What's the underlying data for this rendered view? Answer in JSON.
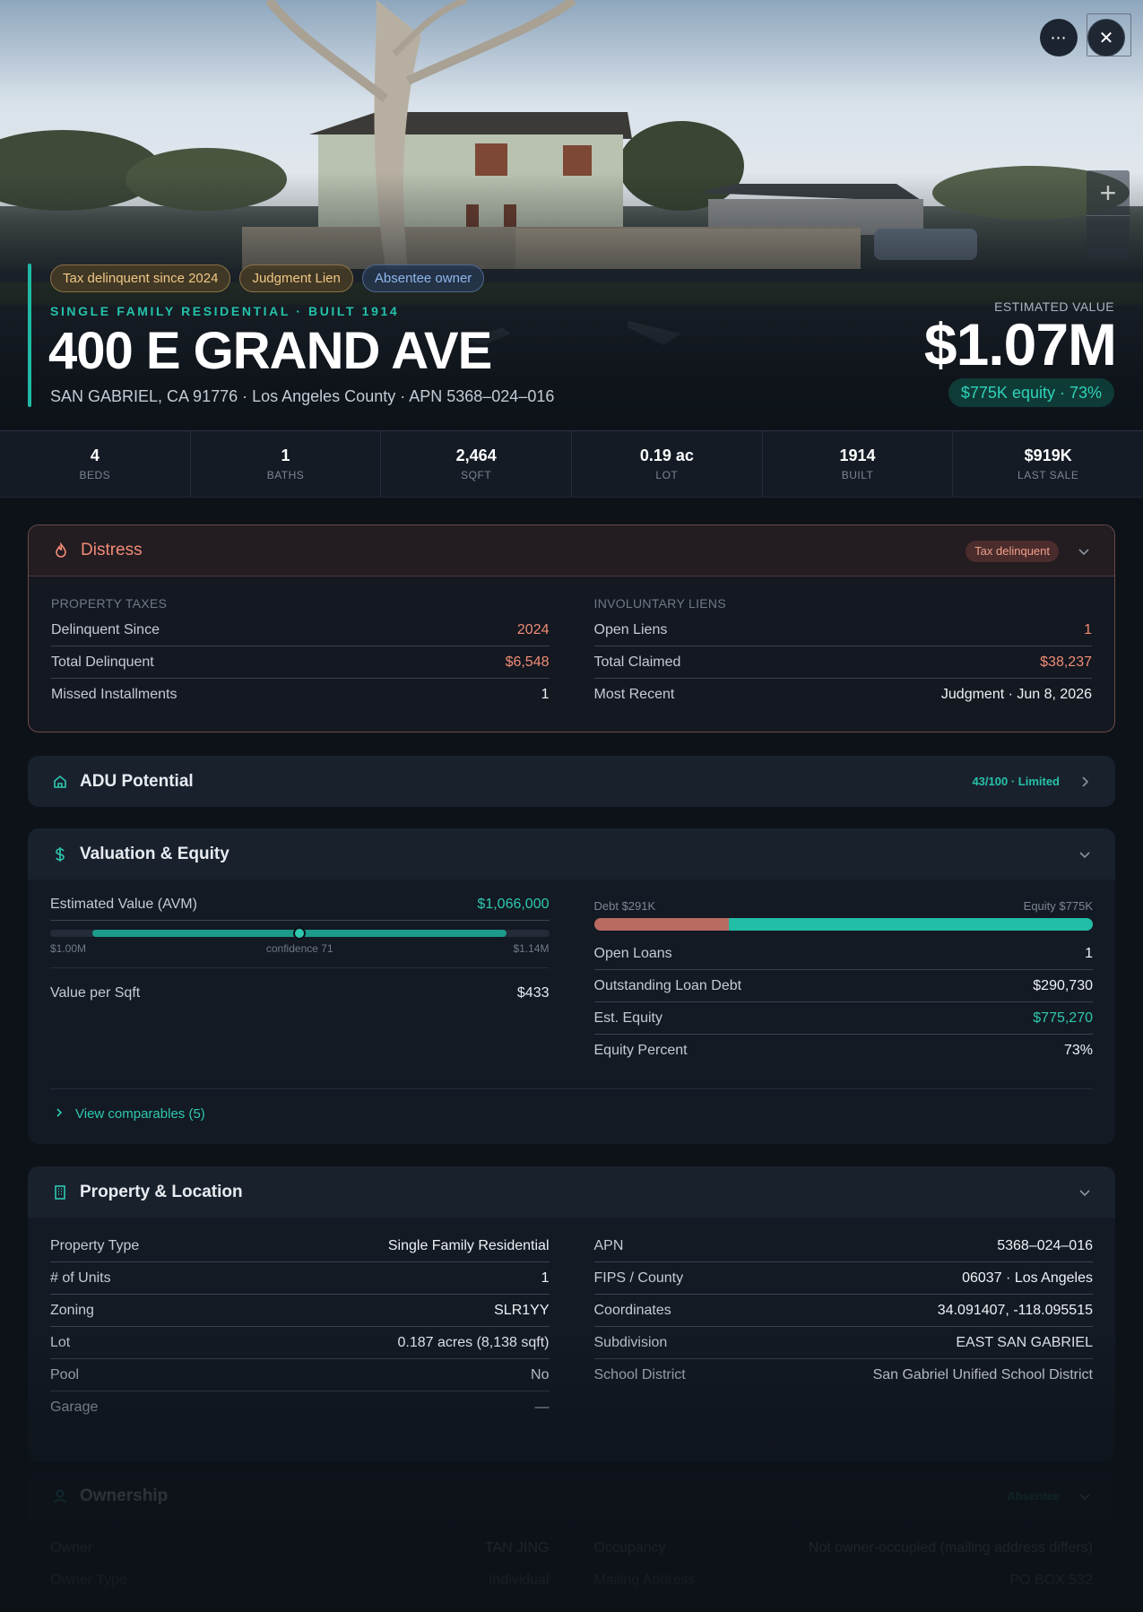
{
  "hero": {
    "more_label": "⋯",
    "close_label": "✕",
    "zoom_in_label": "+",
    "chips": {
      "tax": "Tax delinquent since 2024",
      "lien": "Judgment Lien",
      "absentee": "Absentee owner"
    },
    "subline": "SINGLE FAMILY RESIDENTIAL · BUILT 1914",
    "address": "400 E GRAND AVE",
    "location": "SAN GABRIEL, CA 91776 · Los Angeles County · APN 5368–024–016",
    "estimated_label": "ESTIMATED VALUE",
    "estimated_value": "$1.07M",
    "equity_pill": "$775K equity · 73%"
  },
  "stats": [
    {
      "value": "4",
      "label": "BEDS"
    },
    {
      "value": "1",
      "label": "BATHS"
    },
    {
      "value": "2,464",
      "label": "SQFT"
    },
    {
      "value": "0.19 ac",
      "label": "LOT"
    },
    {
      "value": "1914",
      "label": "BUILT"
    },
    {
      "value": "$919K",
      "label": "LAST SALE"
    }
  ],
  "distress": {
    "title": "Distress",
    "badge": "Tax delinquent",
    "taxes": {
      "label": "PROPERTY TAXES",
      "rows": [
        {
          "k": "Delinquent Since",
          "v": "2024"
        },
        {
          "k": "Total Delinquent",
          "v": "$6,548"
        },
        {
          "k": "Missed Installments",
          "v": "1"
        }
      ]
    },
    "liens": {
      "label": "INVOLUNTARY LIENS",
      "rows": [
        {
          "k": "Open Liens",
          "v": "1"
        },
        {
          "k": "Total Claimed",
          "v": "$38,237"
        },
        {
          "k": "Most Recent",
          "v": "Judgment · Jun 8, 2026"
        }
      ]
    }
  },
  "adu": {
    "title": "ADU Potential",
    "score": "43/100 · Limited"
  },
  "valuation": {
    "title": "Valuation & Equity",
    "avm_label": "Estimated Value (AVM)",
    "avm_value": "$1,066,000",
    "range_low": "$1.00M",
    "range_high": "$1.14M",
    "confidence": "confidence 71",
    "confidence_value": 71,
    "vps_label": "Value per Sqft",
    "vps_value": "$433",
    "debt_label": "Debt $291K",
    "equity_label": "Equity $775K",
    "equity_fraction": 0.73,
    "rows": [
      {
        "k": "Open Loans",
        "v": "1"
      },
      {
        "k": "Outstanding Loan Debt",
        "v": "$290,730"
      },
      {
        "k": "Est. Equity",
        "v": "$775,270"
      },
      {
        "k": "Equity Percent",
        "v": "73%"
      }
    ],
    "comps_label": "View comparables (5)"
  },
  "property": {
    "title": "Property & Location",
    "left": [
      {
        "k": "Property Type",
        "v": "Single Family Residential"
      },
      {
        "k": "# of Units",
        "v": "1"
      },
      {
        "k": "Zoning",
        "v": "SLR1YY"
      },
      {
        "k": "Lot",
        "v": "0.187 acres (8,138 sqft)"
      },
      {
        "k": "Pool",
        "v": "No"
      },
      {
        "k": "Garage",
        "v": "—"
      }
    ],
    "right": [
      {
        "k": "APN",
        "v": "5368–024–016"
      },
      {
        "k": "FIPS / County",
        "v": "06037 · Los Angeles"
      },
      {
        "k": "Coordinates",
        "v": "34.091407, -118.095515"
      },
      {
        "k": "Subdivision",
        "v": "EAST SAN GABRIEL"
      },
      {
        "k": "School District",
        "v": "San Gabriel Unified School District"
      }
    ]
  },
  "ownership": {
    "title": "Ownership",
    "badge": "Absentee",
    "left": [
      {
        "k": "Owner",
        "v": "TAN JING"
      },
      {
        "k": "Owner Type",
        "v": "Individual"
      }
    ],
    "right": [
      {
        "k": "Occupancy",
        "v": "Not owner-occupied (mailing address differs)"
      },
      {
        "k": "Mailing Address",
        "v": "PO BOX 532"
      }
    ]
  },
  "colors": {
    "accent": "#1fb9a4",
    "danger": "#f08c76",
    "debt": "#b96b61",
    "background": "#0d1219"
  }
}
